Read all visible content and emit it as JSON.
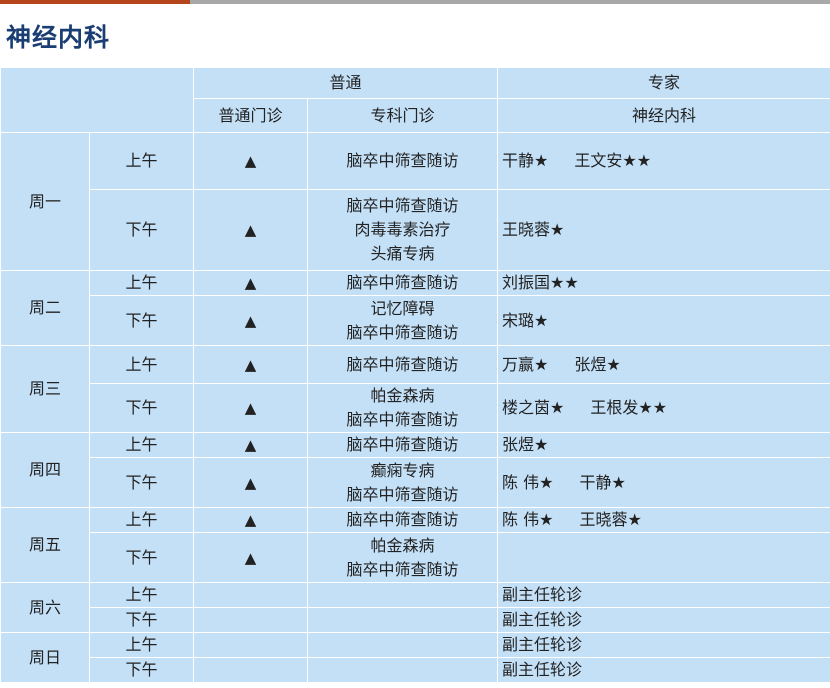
{
  "page_title": "神经内科",
  "header": {
    "group_normal": "普通",
    "group_expert": "专家",
    "col_general": "普通门诊",
    "col_specialty": "专科门诊",
    "col_expert_dept": "神经内科"
  },
  "rows": [
    {
      "day": "周一",
      "am": {
        "period": "上午",
        "general": "▲",
        "specialty": [
          "脑卒中筛查随访"
        ],
        "experts": [
          "干静★",
          "王文安★★"
        ]
      },
      "pm": {
        "period": "下午",
        "general": "▲",
        "specialty": [
          "脑卒中筛查随访",
          "肉毒毒素治疗",
          "头痛专病"
        ],
        "experts": [
          "王晓蓉★"
        ]
      }
    },
    {
      "day": "周二",
      "am": {
        "period": "上午",
        "general": "▲",
        "specialty": [
          "脑卒中筛查随访"
        ],
        "experts": [
          "刘振国★★"
        ]
      },
      "pm": {
        "period": "下午",
        "general": "▲",
        "specialty": [
          "记忆障碍",
          "脑卒中筛查随访"
        ],
        "experts": [
          "宋璐★"
        ]
      }
    },
    {
      "day": "周三",
      "am": {
        "period": "上午",
        "general": "▲",
        "specialty": [
          "脑卒中筛查随访"
        ],
        "experts": [
          "万赢★",
          "张煜★"
        ]
      },
      "pm": {
        "period": "下午",
        "general": "▲",
        "specialty": [
          "帕金森病",
          "脑卒中筛查随访"
        ],
        "experts": [
          "楼之茵★",
          "王根发★★"
        ]
      }
    },
    {
      "day": "周四",
      "am": {
        "period": "上午",
        "general": "▲",
        "specialty": [
          "脑卒中筛查随访"
        ],
        "experts": [
          "张煜★"
        ]
      },
      "pm": {
        "period": "下午",
        "general": "▲",
        "specialty": [
          "癫痫专病",
          "脑卒中筛查随访"
        ],
        "experts": [
          "陈 伟★",
          "干静★"
        ]
      }
    },
    {
      "day": "周五",
      "am": {
        "period": "上午",
        "general": "▲",
        "specialty": [
          "脑卒中筛查随访"
        ],
        "experts": [
          "陈 伟★",
          "王晓蓉★"
        ]
      },
      "pm": {
        "period": "下午",
        "general": "▲",
        "specialty": [
          "帕金森病",
          "脑卒中筛查随访"
        ],
        "experts": []
      }
    },
    {
      "day": "周六",
      "am": {
        "period": "上午",
        "general": "",
        "specialty": [],
        "experts": [
          "副主任轮诊"
        ]
      },
      "pm": {
        "period": "下午",
        "general": "",
        "specialty": [],
        "experts": [
          "副主任轮诊"
        ]
      }
    },
    {
      "day": "周日",
      "am": {
        "period": "上午",
        "general": "",
        "specialty": [],
        "experts": [
          "副主任轮诊"
        ]
      },
      "pm": {
        "period": "下午",
        "general": "",
        "specialty": [],
        "experts": [
          "副主任轮诊"
        ]
      }
    }
  ]
}
